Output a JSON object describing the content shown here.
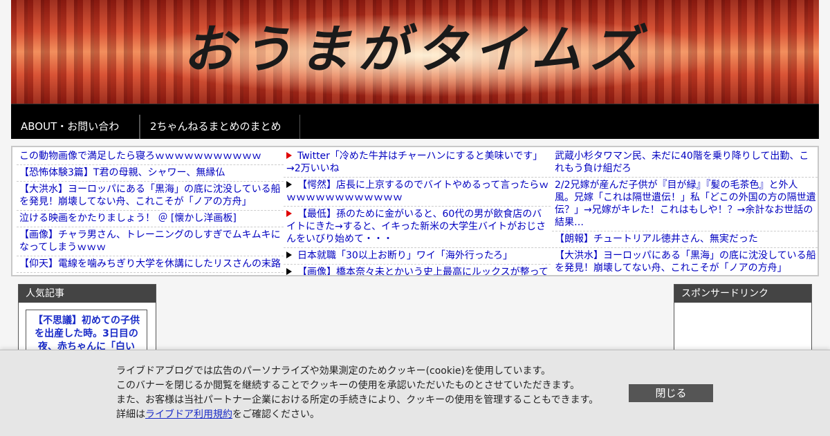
{
  "header": {
    "site_title": "おうまがタイムズ"
  },
  "nav": {
    "items": [
      {
        "label": "ABOUT・お問い合わせ"
      },
      {
        "label": "2ちゃんねるまとめのまとめ"
      }
    ]
  },
  "antenna": {
    "col1": [
      {
        "text": "この動物画像で満足したら寝ろｗｗｗｗｗｗｗｗｗｗｗ"
      },
      {
        "text": "【恐怖体験3篇】T君の母親、シャワー、無縁仏"
      },
      {
        "text": "【大洪水】ヨーロッパにある「黒海」の底に沈没している船を発見！崩壊してない舟、これこそが「ノアの方舟」"
      },
      {
        "text": "泣ける映画をかたりましょう！ ＠ [懐かし洋画板]"
      },
      {
        "text": "【画像】チャラ男さん、トレーニングのしすぎでムキムキになってしまうｗｗｗ"
      },
      {
        "text": "【仰天】電線を噛みちぎり大学を休講にしたリスさんの末路"
      }
    ],
    "col2": [
      {
        "text": "Twitter「冷めた牛丼はチャーハンにすると美味いです」→2万いいね",
        "marker": "red"
      },
      {
        "text": "【愕然】店長に上京するのでバイトやめるって言ったらｗｗｗｗｗｗｗｗｗｗｗｗｗ",
        "marker": "black"
      },
      {
        "text": "【最低】孫のために金がいると、60代の男が飲食店のバイトにきた→すると、イキった新米の大学生バイトがおじさんをいびり始めて・・・",
        "marker": "red"
      },
      {
        "text": "日本就職「30以上お断り」ワイ「海外行ったろ」",
        "marker": "black"
      },
      {
        "text": "【画像】橋本奈々未とかいう史上最高にルックスが整ってる",
        "marker": "black"
      }
    ],
    "col3": [
      {
        "text": "武蔵小杉タワマン民、未だに40階を乗り降りして出勤、これもう負け組だろ"
      },
      {
        "text": "2/2兄嫁が産んだ子供が『目が緑』『髪の毛茶色』と外人風。兄嫁「これは隔世遺伝！」私「どこの外国の方の隔世遺伝？」→兄嫁がキレた！これはもしや！？→余計なお世話の結果…"
      },
      {
        "text": "【朗報】チュートリアル徳井さん、無実だった"
      },
      {
        "text": "【大洪水】ヨーロッパにある「黒海」の底に沈没している船を発見！崩壊してない舟、これこそが「ノアの方舟」"
      }
    ]
  },
  "sidebar_left": {
    "heading": "人気記事",
    "featured": "【不思議】初めての子供を出産した時。3日目の夜、赤ちゃんに「白い"
  },
  "sidebar_right": {
    "heading": "スポンサードリンク"
  },
  "cookie": {
    "line1": "ライブドアブログでは広告のパーソナライズや効果測定のためクッキー(cookie)を使用しています。",
    "line2": "このバナーを閉じるか閲覧を継続することでクッキーの使用を承認いただいたものとさせていただきます。",
    "line3": "また、お客様は当社パートナー企業における所定の手続きにより、クッキーの使用を管理することもできます。",
    "line4_prefix": "詳細は",
    "line4_link": "ライブドア利用規約",
    "line4_suffix": "をご確認ください。",
    "close_label": "閉じる"
  }
}
